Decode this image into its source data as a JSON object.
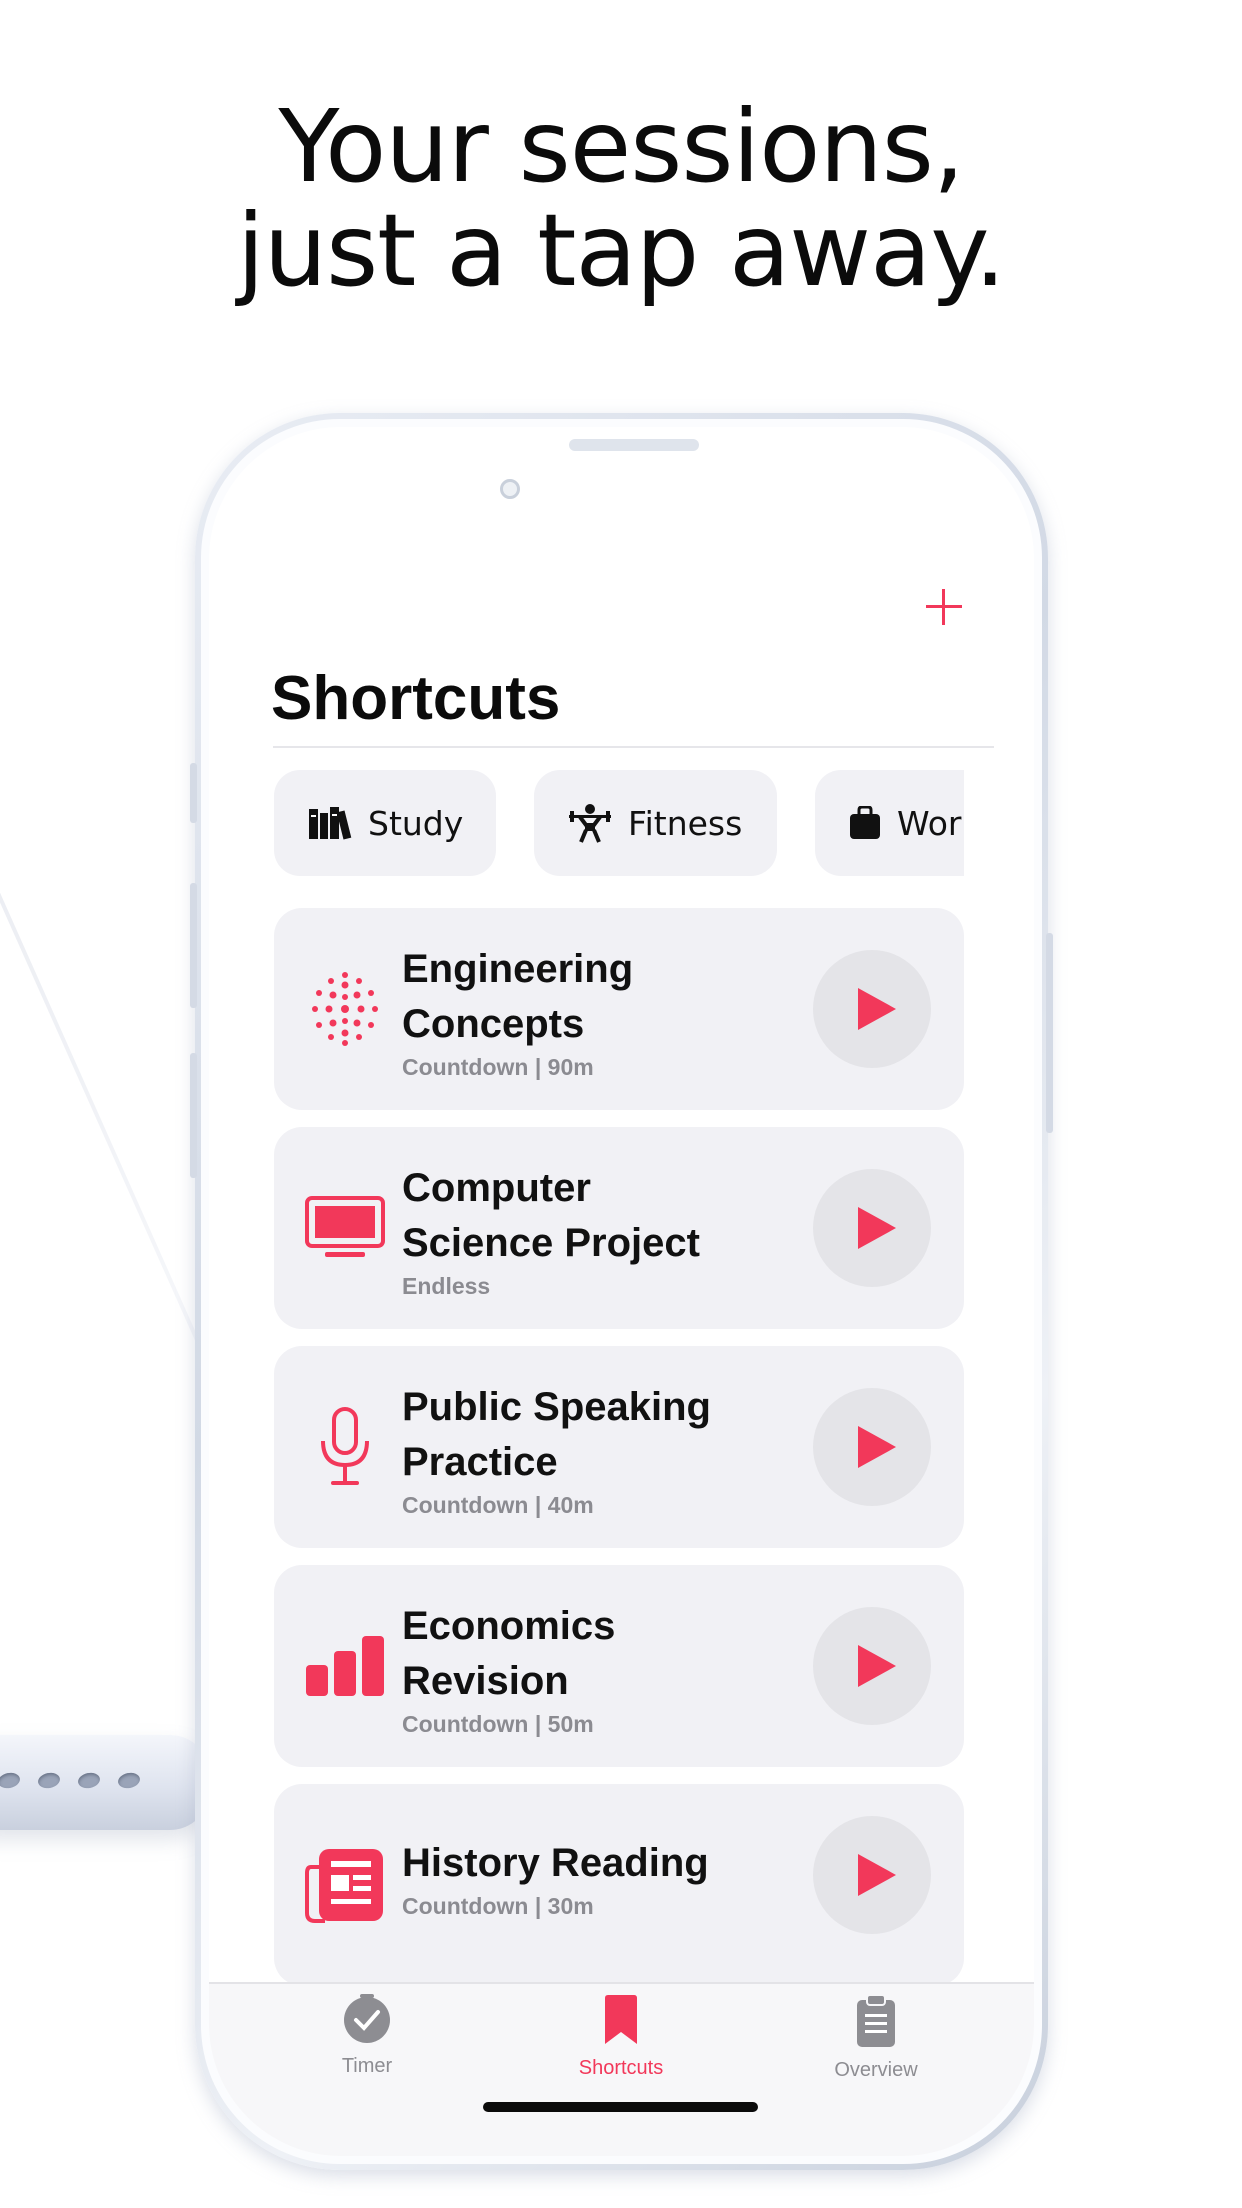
{
  "headline": {
    "line1": "Your sessions,",
    "line2": "just a tap away."
  },
  "header": {
    "title": "Shortcuts"
  },
  "colors": {
    "accent": "#f2385a",
    "card_bg": "#f1f1f5",
    "muted": "#8b8b91"
  },
  "categories": [
    {
      "label": "Study",
      "icon": "books-icon"
    },
    {
      "label": "Fitness",
      "icon": "weightlifting-icon"
    },
    {
      "label": "Wor",
      "icon": "briefcase-icon"
    }
  ],
  "shortcuts": [
    {
      "title_line1": "Engineering",
      "title_line2": "Concepts",
      "subtitle": "Countdown | 90m",
      "icon": "dots-sphere-icon"
    },
    {
      "title_line1": "Computer",
      "title_line2": "Science Project",
      "subtitle": "Endless",
      "icon": "display-icon"
    },
    {
      "title_line1": "Public Speaking",
      "title_line2": "Practice",
      "subtitle": "Countdown | 40m",
      "icon": "microphone-icon"
    },
    {
      "title_line1": "Economics",
      "title_line2": "Revision",
      "subtitle": "Countdown | 50m",
      "icon": "bar-chart-icon"
    },
    {
      "title_line1": "History Reading",
      "title_line2": "",
      "subtitle": "Countdown | 30m",
      "icon": "newspaper-icon"
    }
  ],
  "tabs": [
    {
      "label": "Timer",
      "icon": "clock-check-icon",
      "active": false
    },
    {
      "label": "Shortcuts",
      "icon": "bookmark-icon",
      "active": true
    },
    {
      "label": "Overview",
      "icon": "clipboard-icon",
      "active": false
    }
  ]
}
